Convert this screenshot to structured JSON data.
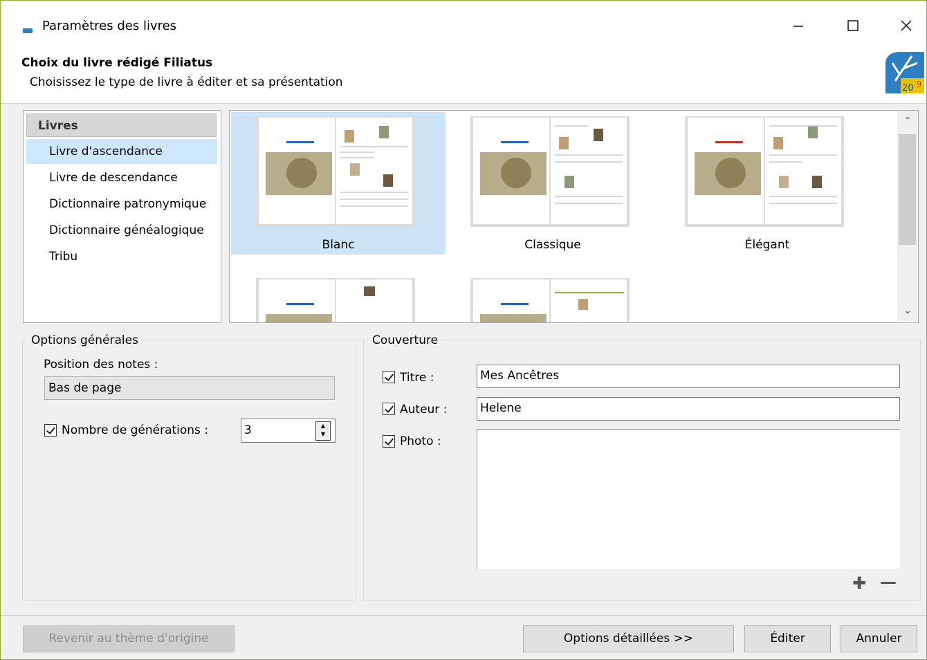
{
  "window": {
    "title": "Paramètres des livres"
  },
  "header": {
    "title": "Choix du livre rédigé Filiatus",
    "subtitle": "Choisissez le type de livre à éditer et sa présentation",
    "logo_text": "20"
  },
  "books": {
    "header": "Livres",
    "items": [
      "Livre d'ascendance",
      "Livre de descendance",
      "Dictionnaire patronymique",
      "Dictionnaire généalogique",
      "Tribu"
    ],
    "selected": "Livre d'ascendance"
  },
  "themes": {
    "items": [
      "Blanc",
      "Classique",
      "Élégant"
    ],
    "selected": "Blanc",
    "accent_colors": {
      "Blanc": "#2a63b8",
      "Classique": "#2a63b8",
      "Élégant": "#c0392b"
    }
  },
  "options_generales": {
    "legend": "Options générales",
    "position_notes_label": "Position des notes :",
    "position_notes_value": "Bas de page",
    "nombre_generations_label": "Nombre de générations :",
    "nombre_generations_checked": true,
    "nombre_generations_value": "3"
  },
  "couverture": {
    "legend": "Couverture",
    "titre_label": "Titre :",
    "titre_value": "Mes Ancêtres",
    "auteur_label": "Auteur :",
    "auteur_value": "Helene",
    "photo_label": "Photo :"
  },
  "footer": {
    "revert_label": "Revenir au thème d'origine",
    "options_label": "Options détaillées >>",
    "edit_label": "Éditer",
    "cancel_label": "Annuler"
  },
  "colors": {
    "selection": "#cde8ff",
    "border_accent": "#8fae3a",
    "logo_blue": "#2d7fc1",
    "logo_gold": "#e8c400"
  }
}
